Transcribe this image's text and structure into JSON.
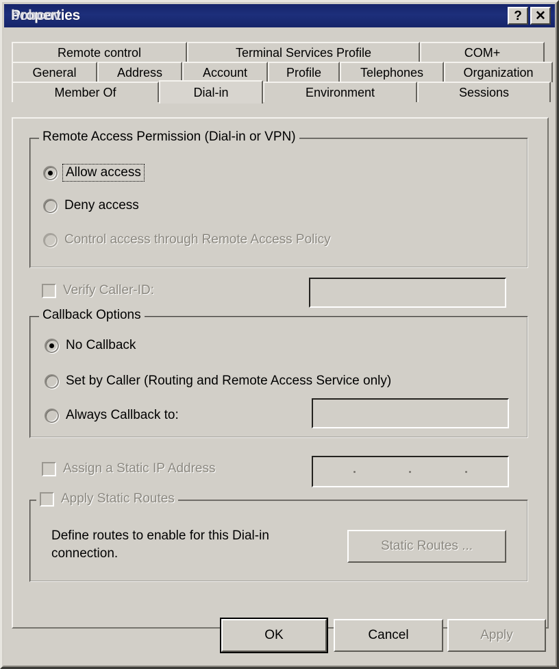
{
  "window": {
    "title": "Properties",
    "title_overlay": "bobcov",
    "help_button": "?",
    "close_button": "✕"
  },
  "tabs": {
    "row1": [
      {
        "label": "Remote control",
        "selected": false
      },
      {
        "label": "Terminal Services Profile",
        "selected": false
      },
      {
        "label": "COM+",
        "selected": false
      }
    ],
    "row2": [
      {
        "label": "General",
        "selected": false
      },
      {
        "label": "Address",
        "selected": false
      },
      {
        "label": "Account",
        "selected": false
      },
      {
        "label": "Profile",
        "selected": false
      },
      {
        "label": "Telephones",
        "selected": false
      },
      {
        "label": "Organization",
        "selected": false
      }
    ],
    "row3": [
      {
        "label": "Member Of",
        "selected": false
      },
      {
        "label": "Dial-in",
        "selected": true
      },
      {
        "label": "Environment",
        "selected": false
      },
      {
        "label": "Sessions",
        "selected": false
      }
    ]
  },
  "remote_access_permission": {
    "legend": "Remote Access Permission (Dial-in or VPN)",
    "options": [
      {
        "label": "Allow access",
        "accel": "w",
        "selected": true,
        "disabled": false,
        "focused": true
      },
      {
        "label": "Deny access",
        "accel": "D",
        "selected": false,
        "disabled": false,
        "focused": false
      },
      {
        "label": "Control access through Remote Access Policy",
        "accel": "P",
        "selected": false,
        "disabled": true,
        "focused": false
      }
    ]
  },
  "verify_caller_id": {
    "label": "Verify Caller-ID:",
    "accel": "V",
    "checked": false,
    "disabled": true,
    "value": ""
  },
  "callback_options": {
    "legend": "Callback Options",
    "options": [
      {
        "label": "No Callback",
        "accel": "C",
        "selected": true
      },
      {
        "label": "Set by Caller (Routing and Remote Access Service only)",
        "accel": "S",
        "selected": false
      },
      {
        "label": "Always Callback to:",
        "accel": "y",
        "selected": false
      }
    ],
    "callback_value": ""
  },
  "static_ip": {
    "label": "Assign a Static IP Address",
    "accel": "g",
    "checked": false,
    "disabled": true,
    "value": ""
  },
  "static_routes": {
    "label": "Apply Static Routes",
    "accel": "R",
    "checked": false,
    "disabled": true,
    "description_line1": "Define routes to enable for this Dial-in",
    "description_line2": "connection.",
    "button_label": "Static Routes ...",
    "button_accel": "u",
    "button_disabled": true
  },
  "footer": {
    "ok": "OK",
    "cancel": "Cancel",
    "apply": "Apply",
    "apply_disabled": true
  },
  "colors": {
    "titlebar": "#16256a",
    "dialog_face": "#d2cfc8",
    "text": "#000000",
    "disabled_text": "#8b8880"
  }
}
